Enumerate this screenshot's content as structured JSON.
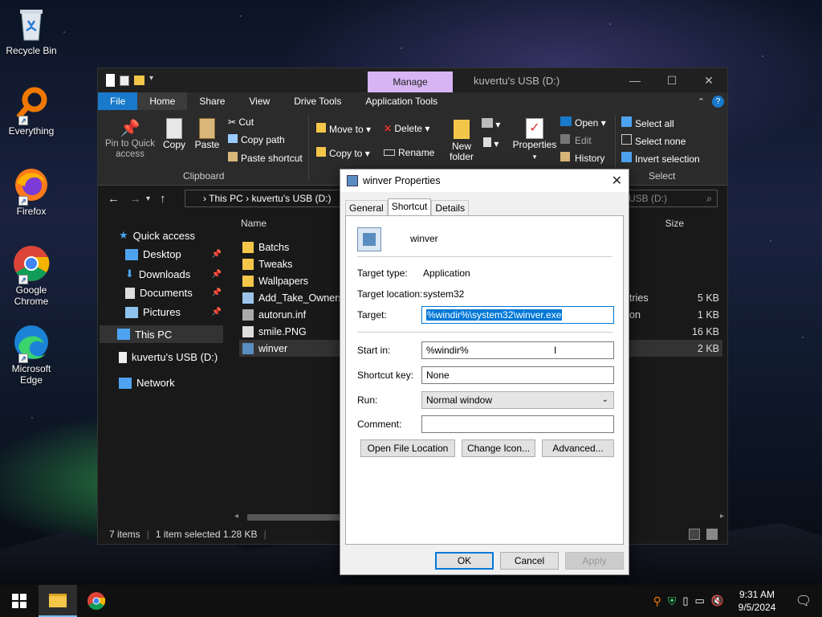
{
  "desktop": {
    "icons": [
      {
        "label": "Recycle Bin",
        "icon": "recycle-bin-icon"
      },
      {
        "label": "Everything",
        "icon": "everything-search-icon"
      },
      {
        "label": "Firefox",
        "icon": "firefox-icon"
      },
      {
        "label": "Google Chrome",
        "icon": "chrome-icon"
      },
      {
        "label": "Microsoft Edge",
        "icon": "edge-icon"
      }
    ]
  },
  "explorer": {
    "title": "kuvertu's USB (D:)",
    "context_tabs": [
      "Manage",
      "Manage"
    ],
    "context_tab_colors": [
      "#f7c4a4",
      "#d7b4f4"
    ],
    "tabs": [
      "File",
      "Home",
      "Share",
      "View",
      "Drive Tools",
      "Application Tools"
    ],
    "ribbon": {
      "pin_label": "Pin to Quick access",
      "copy": "Copy",
      "paste": "Paste",
      "cut": "Cut",
      "copy_path": "Copy path",
      "paste_shortcut": "Paste shortcut",
      "clipboard": "Clipboard",
      "move_to": "Move to",
      "copy_to": "Copy to",
      "delete": "Delete",
      "rename": "Rename",
      "new_folder": "New folder",
      "properties": "Properties",
      "open": "Open",
      "edit": "Edit",
      "history": "History",
      "select_all": "Select all",
      "select_none": "Select none",
      "invert_selection": "Invert selection",
      "select": "Select"
    },
    "address": {
      "path1": "This PC",
      "path2": "kuvertu's USB (D:)",
      "search": "USB (D:)"
    },
    "nav": {
      "quick_access": "Quick access",
      "desktop": "Desktop",
      "downloads": "Downloads",
      "documents": "Documents",
      "pictures": "Pictures",
      "this_pc": "This PC",
      "usb": "kuvertu's USB (D:)",
      "network": "Network"
    },
    "columns": {
      "name": "Name",
      "size": "Size"
    },
    "files": [
      {
        "name": "Batchs",
        "type": "",
        "size": ""
      },
      {
        "name": "Tweaks",
        "type": "",
        "size": ""
      },
      {
        "name": "Wallpapers",
        "type": "",
        "size": ""
      },
      {
        "name": "Add_Take_Ownersh",
        "type": "tries",
        "size": "5 KB"
      },
      {
        "name": "autorun.inf",
        "type": "on",
        "size": "1 KB"
      },
      {
        "name": "smile.PNG",
        "type": "",
        "size": "16 KB"
      },
      {
        "name": "winver",
        "type": "",
        "size": "2 KB"
      }
    ],
    "status": {
      "count": "7 items",
      "selected": "1 item selected  1.28 KB"
    }
  },
  "dialog": {
    "title": "winver Properties",
    "tabs": [
      "General",
      "Shortcut",
      "Details"
    ],
    "name": "winver",
    "target_type_label": "Target type:",
    "target_type": "Application",
    "target_location_label": "Target location:",
    "target_location": "system32",
    "target_label": "Target:",
    "target": "%windir%\\system32\\winver.exe",
    "start_in_label": "Start in:",
    "start_in": "%windir%",
    "shortcut_key_label": "Shortcut key:",
    "shortcut_key": "None",
    "run_label": "Run:",
    "run": "Normal window",
    "comment_label": "Comment:",
    "comment": "",
    "open_file_location": "Open File Location",
    "change_icon": "Change Icon...",
    "advanced": "Advanced...",
    "ok": "OK",
    "cancel": "Cancel",
    "apply": "Apply"
  },
  "taskbar": {
    "time": "9:31 AM",
    "date": "9/5/2024"
  }
}
